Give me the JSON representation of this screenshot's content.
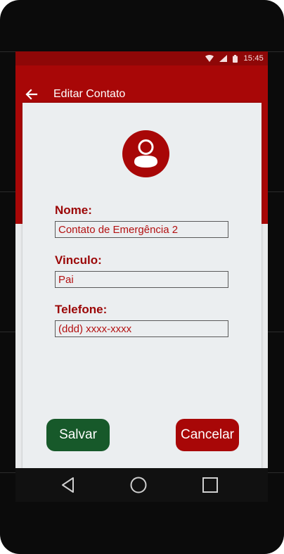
{
  "status_bar": {
    "time": "15:45",
    "icons": [
      "wifi-icon",
      "signal-icon",
      "battery-icon"
    ]
  },
  "app_bar": {
    "title": "Editar Contato",
    "back_icon": "back-arrow-icon"
  },
  "form": {
    "avatar_icon": "user-avatar-icon",
    "name": {
      "label": "Nome:",
      "value": "Contato de Emergência 2"
    },
    "relation": {
      "label": "Vinculo:",
      "value": "Pai"
    },
    "phone": {
      "label": "Telefone:",
      "value": "",
      "placeholder": "(ddd) xxxx-xxxx"
    }
  },
  "actions": {
    "save_label": "Salvar",
    "cancel_label": "Cancelar"
  },
  "nav_bar": {
    "icons": [
      "nav-back-icon",
      "nav-home-icon",
      "nav-recents-icon"
    ]
  },
  "colors": {
    "primary": "#a80707",
    "status_bar": "#8e0707",
    "save_button": "#17592a",
    "label_text": "#9b0606",
    "card_background": "#ebeef0"
  }
}
